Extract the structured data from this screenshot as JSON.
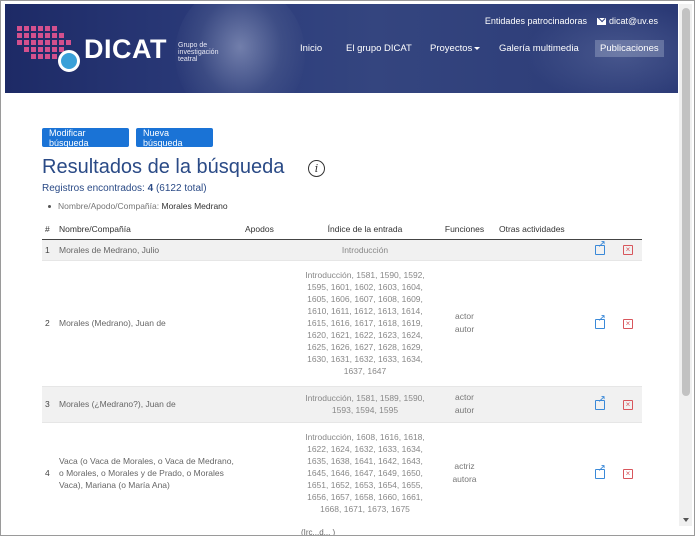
{
  "header": {
    "logo": {
      "text": "DICAT",
      "subtitle_line1": "Grupo de",
      "subtitle_line2": "investigación",
      "subtitle_line3": "teatral"
    },
    "top_links": {
      "sponsors": "Entidades patrocinadoras",
      "email": "dicat@uv.es"
    },
    "nav": [
      {
        "label": "Inicio"
      },
      {
        "label": "El grupo DICAT"
      },
      {
        "label": "Proyectos"
      },
      {
        "label": "Galería multimedia"
      },
      {
        "label": "Publicaciones",
        "active": true
      }
    ]
  },
  "actions": {
    "modify": "Modificar búsqueda",
    "new": "Nueva búsqueda"
  },
  "page_title": "Resultados de la búsqueda",
  "info_symbol": "i",
  "records": {
    "label": "Registros encontrados:",
    "count": "4",
    "total": "(6122 total)"
  },
  "criteria": {
    "label": "Nombre/Apodo/Compañía:",
    "value": "Morales Medrano"
  },
  "table": {
    "headers": [
      "#",
      "Nombre/Compañía",
      "Apodos",
      "Índice de la entrada",
      "Funciones",
      "Otras actividades"
    ],
    "rows": [
      {
        "num": "1",
        "name": "Morales de Medrano, Julio",
        "nicknames": "",
        "index": "Introducción",
        "functions": [
          "",
          ""
        ],
        "other": ""
      },
      {
        "num": "2",
        "name": "Morales (Medrano), Juan de",
        "nicknames": "",
        "index": "Introducción, 1581, 1590, 1592, 1595, 1601, 1602, 1603, 1604, 1605, 1606, 1607, 1608, 1609, 1610, 1611, 1612, 1613, 1614, 1615, 1616, 1617, 1618, 1619, 1620, 1621, 1622, 1623, 1624, 1625, 1626, 1627, 1628, 1629, 1630, 1631, 1632, 1633, 1634, 1637, 1647",
        "functions": [
          "actor",
          "autor"
        ],
        "other": ""
      },
      {
        "num": "3",
        "name": "Morales (¿Medrano?), Juan de",
        "nicknames": "",
        "index": "Introducción, 1581, 1589, 1590, 1593, 1594, 1595",
        "functions": [
          "actor",
          "autor"
        ],
        "other": ""
      },
      {
        "num": "4",
        "name": "Vaca (o Vaca de Morales, o Vaca de Medrano, o Morales, o Morales y de Prado, o Morales Vaca), Mariana (o María Ana)",
        "nicknames": "",
        "index": "Introducción, 1608, 1616, 1618, 1622, 1624, 1632, 1633, 1634, 1635, 1638, 1641, 1642, 1643, 1645, 1646, 1647, 1649, 1650, 1651, 1652, 1653, 1654, 1655, 1656, 1657, 1658, 1660, 1661, 1668, 1671, 1673, 1675",
        "functions": [
          "actriz",
          "autora"
        ],
        "other": ""
      }
    ],
    "icons": {
      "open": "external-link-icon",
      "delete": "close-box-icon"
    }
  },
  "footer_fragment": "(Irc...d... )"
}
